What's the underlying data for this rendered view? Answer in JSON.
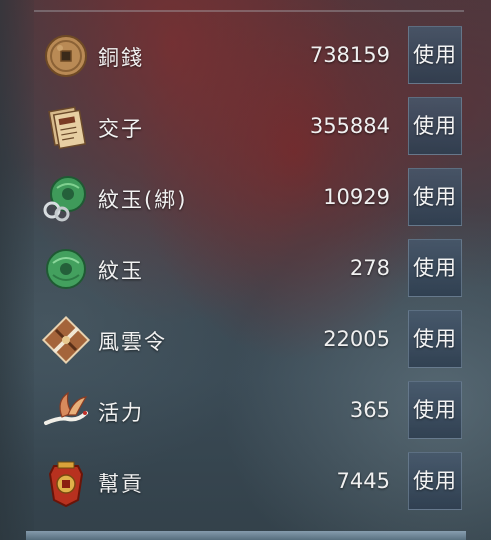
{
  "items": [
    {
      "name": "銅錢",
      "count": "738159",
      "action": "使用",
      "icon": "copper-coin-icon"
    },
    {
      "name": "交子",
      "count": "355884",
      "action": "使用",
      "icon": "paper-money-icon"
    },
    {
      "name": "紋玉(綁)",
      "count": "10929",
      "action": "使用",
      "icon": "bound-jade-icon"
    },
    {
      "name": "紋玉",
      "count": "278",
      "action": "使用",
      "icon": "jade-icon"
    },
    {
      "name": "風雲令",
      "count": "22005",
      "action": "使用",
      "icon": "crossed-swords-token-icon"
    },
    {
      "name": "活力",
      "count": "365",
      "action": "使用",
      "icon": "crane-bird-icon"
    },
    {
      "name": "幫貢",
      "count": "7445",
      "action": "使用",
      "icon": "guild-token-icon"
    }
  ],
  "colors": {
    "button_bg": "#3a4e64",
    "text": "#f2f2f2"
  }
}
